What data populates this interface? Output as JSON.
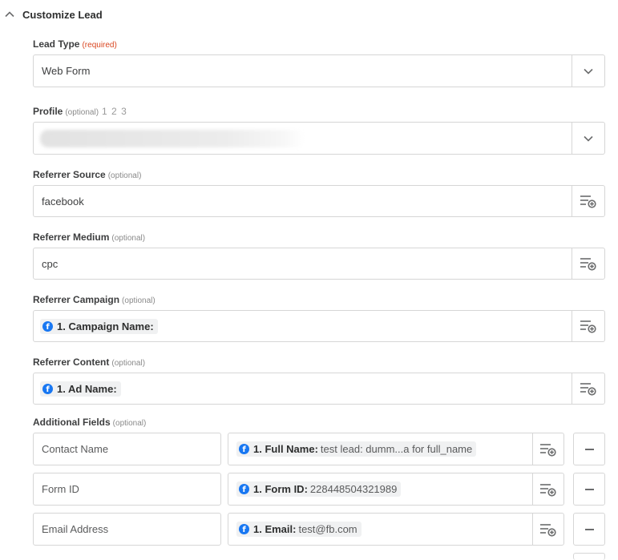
{
  "section": {
    "title": "Customize Lead"
  },
  "lead_type": {
    "label": "Lead Type",
    "req": "(required)",
    "value": "Web Form"
  },
  "profile": {
    "label": "Profile",
    "opt": "(optional)",
    "steps": "1 2 3"
  },
  "referrer_source": {
    "label": "Referrer Source",
    "opt": "(optional)",
    "value": "facebook"
  },
  "referrer_medium": {
    "label": "Referrer Medium",
    "opt": "(optional)",
    "value": "cpc"
  },
  "referrer_campaign": {
    "label": "Referrer Campaign",
    "opt": "(optional)",
    "pill_key": "1. Campaign Name:"
  },
  "referrer_content": {
    "label": "Referrer Content",
    "opt": "(optional)",
    "pill_key": "1. Ad Name:"
  },
  "additional_fields": {
    "label": "Additional Fields",
    "opt": "(optional)",
    "rows": [
      {
        "key": "Contact Name",
        "pill_key": "1. Full Name:",
        "pill_value": "test lead: dumm...a for full_name"
      },
      {
        "key": "Form ID",
        "pill_key": "1. Form ID:",
        "pill_value": "228448504321989"
      },
      {
        "key": "Email Address",
        "pill_key": "1. Email:",
        "pill_value": "test@fb.com"
      }
    ]
  },
  "icons": {
    "fb_glyph": "f"
  },
  "colors": {
    "required": "#d94620",
    "facebook": "#1877f2",
    "border": "#d6d6d6"
  }
}
